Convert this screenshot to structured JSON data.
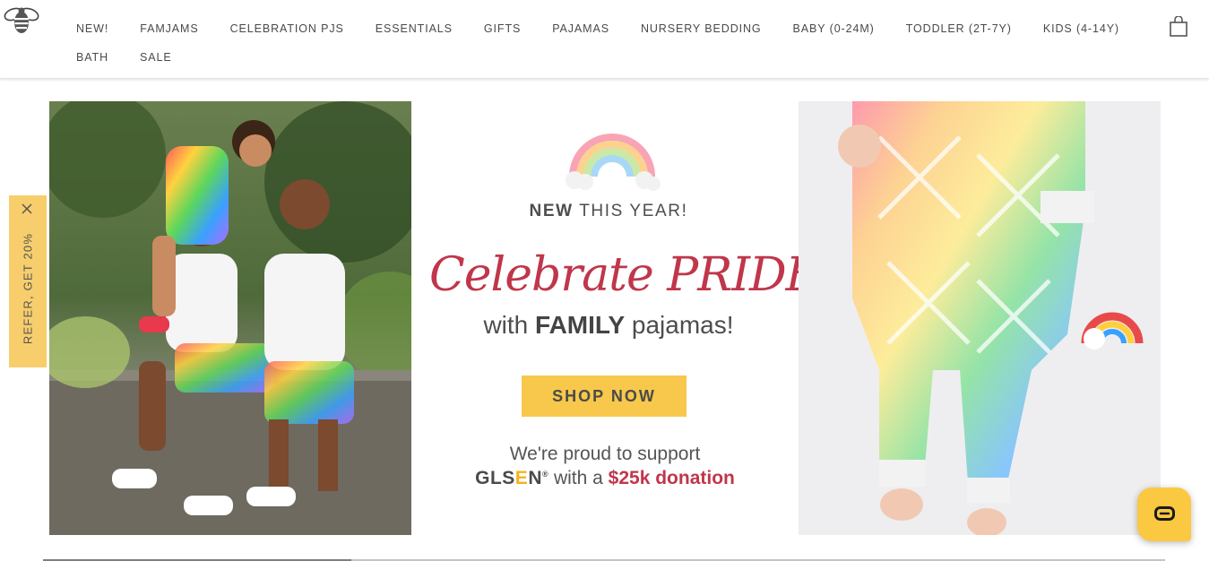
{
  "header": {
    "logo_icon": "bee-logo-icon",
    "nav_row1": [
      {
        "label": "NEW!"
      },
      {
        "label": "FAMJAMS"
      },
      {
        "label": "CELEBRATION PJS"
      },
      {
        "label": "ESSENTIALS"
      },
      {
        "label": "GIFTS"
      },
      {
        "label": "PAJAMAS"
      },
      {
        "label": "NURSERY BEDDING"
      },
      {
        "label": "BABY (0-24M)"
      },
      {
        "label": "TODDLER (2T-7Y)"
      },
      {
        "label": "KIDS (4-14Y)"
      }
    ],
    "nav_row2": [
      {
        "label": "BATH"
      },
      {
        "label": "SALE"
      }
    ],
    "cart_icon": "shopping-bag-icon"
  },
  "promo": {
    "new_bold": "NEW",
    "new_rest": "THIS YEAR!",
    "headline": "Celebrate PRIDE",
    "family_pre": "with",
    "family_bold": "FAMILY",
    "family_post": "pajamas!",
    "cta_label": "SHOP NOW",
    "support_line": "We're proud to support",
    "glsen_gl": "GLS",
    "glsen_e": "E",
    "glsen_n": "N",
    "reg_mark": "®",
    "with_a": "with a",
    "amount": "$25k donation",
    "colors": {
      "accent": "#c0364b",
      "cta": "#f7c84b",
      "gold": "#f4b320"
    }
  },
  "referral": {
    "label": "REFER, GET 20%",
    "close_icon": "close-icon"
  },
  "chat": {
    "icon": "chat-bubble-icon"
  }
}
